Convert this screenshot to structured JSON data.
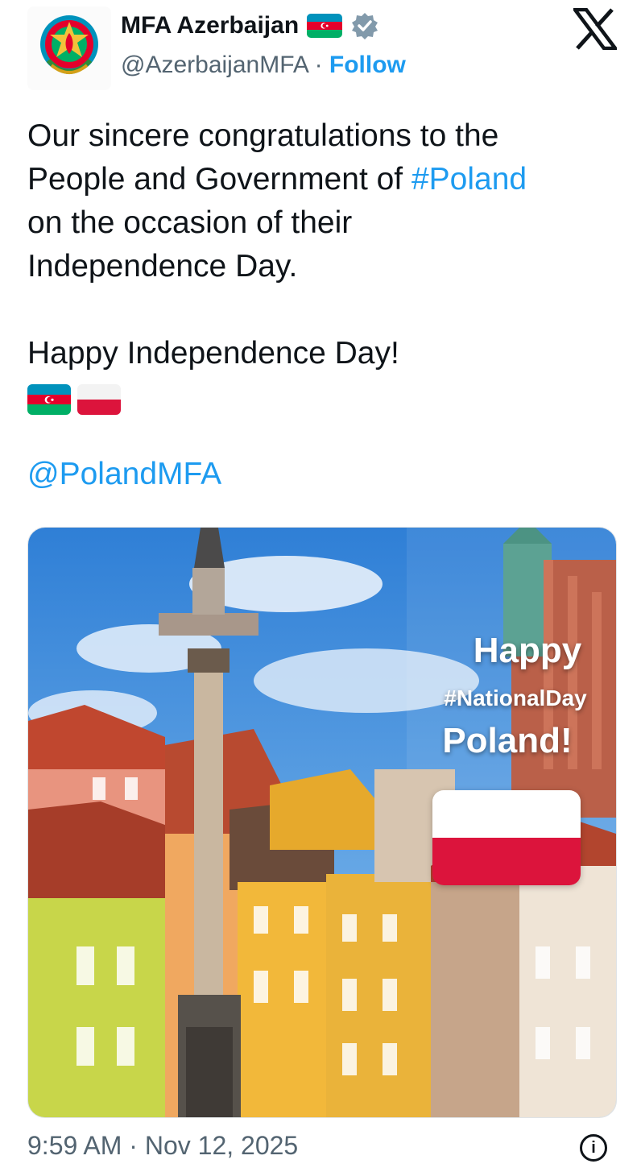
{
  "header": {
    "display_name": "MFA Azerbaijan",
    "handle": "@AzerbaijanMFA",
    "separator": " · ",
    "follow_label": "Follow",
    "icons": [
      "azerbaijan-emblem-avatar",
      "azerbaijan-flag-icon",
      "verified-badge-icon",
      "x-logo-icon"
    ]
  },
  "tweet": {
    "text_lines": [
      "Our sincere congratulations to the",
      "People and Government of ",
      "on the occasion of their",
      "Independence Day."
    ],
    "hashtag": "#Poland",
    "line2": "Happy Independence Day!",
    "flag_emojis": [
      "azerbaijan-flag",
      "poland-flag"
    ],
    "mention": "@PolandMFA"
  },
  "media": {
    "overlay": {
      "happy": "Happy",
      "hashtag": "#NationalDay",
      "country": "Poland!"
    },
    "colors": {
      "flag_red": "#dc143c",
      "flag_white": "#ffffff"
    }
  },
  "footer": {
    "time": "9:59 AM",
    "separator": " · ",
    "date": "Nov 12, 2025",
    "info_icon": "info-icon"
  },
  "colors": {
    "link": "#1d9bf0",
    "text": "#0f1419",
    "muted": "#536471"
  }
}
